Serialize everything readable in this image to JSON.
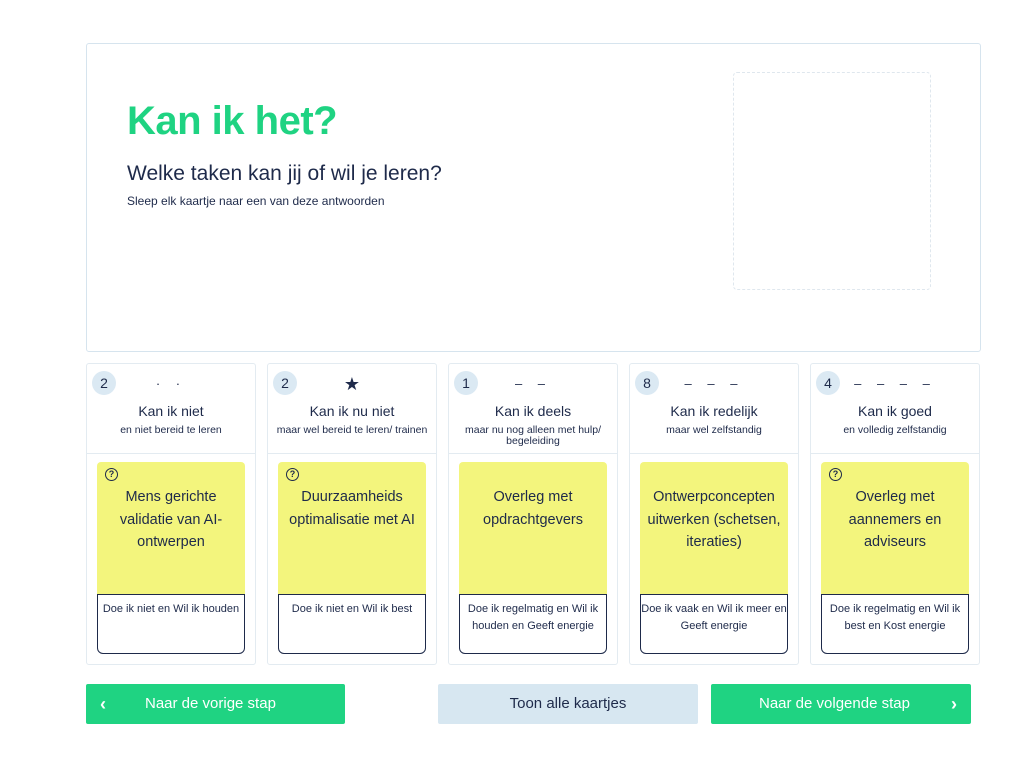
{
  "header": {
    "title": "Kan ik het?",
    "subtitle": "Welke taken kan jij of wil je leren?",
    "instruction": "Sleep elk kaartje naar een van deze antwoorden"
  },
  "columns": [
    {
      "count": "2",
      "marks": "· ·",
      "title": "Kan ik niet",
      "subtitle": "en niet bereid te leren",
      "card": {
        "text": "Mens gerichte validatie van AI-ontwerpen",
        "note": "Doe ik niet en Wil ik houden",
        "has_help_icon": true
      }
    },
    {
      "count": "2",
      "marks": "★",
      "title": "Kan ik nu niet",
      "subtitle": "maar wel bereid te leren/ trainen",
      "card": {
        "text": "Duurzaamheids optimalisatie met AI",
        "note": "Doe ik niet en Wil ik best",
        "has_help_icon": true
      }
    },
    {
      "count": "1",
      "marks": "– –",
      "title": "Kan ik deels",
      "subtitle": "maar nu nog alleen met hulp/ begeleiding",
      "card": {
        "text": "Overleg met opdrachtgevers",
        "note": "Doe ik regelmatig en Wil ik houden en Geeft energie",
        "has_help_icon": false
      }
    },
    {
      "count": "8",
      "marks": "– – –",
      "title": "Kan ik redelijk",
      "subtitle": "maar wel zelfstandig",
      "card": {
        "text": "Ontwerpconcepten uitwerken (schetsen, iteraties)",
        "note": "Doe ik vaak en Wil ik meer en Geeft energie",
        "has_help_icon": false
      }
    },
    {
      "count": "4",
      "marks": "– – – –",
      "title": "Kan ik goed",
      "subtitle": "en volledig zelfstandig",
      "card": {
        "text": "Overleg met aannemers en adviseurs",
        "note": "Doe ik regelmatig en Wil ik best en Kost energie",
        "has_help_icon": true
      }
    }
  ],
  "buttons": {
    "prev": "Naar de vorige stap",
    "all": "Toon alle kaartjes",
    "next": "Naar de volgende stap"
  },
  "colors": {
    "accent": "#1fd382",
    "card": "#f3f57d",
    "text": "#1e2a4a",
    "secondary_button": "#d7e7f1"
  }
}
